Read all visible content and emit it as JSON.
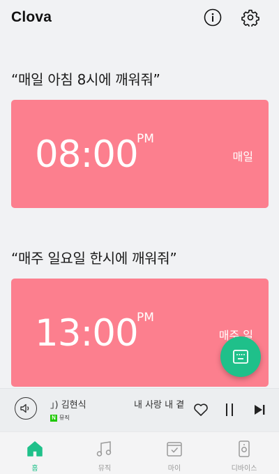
{
  "header": {
    "title": "Clova",
    "info_icon": "info-icon",
    "settings_icon": "gear-icon"
  },
  "alarms": [
    {
      "quote": "“매일 아침 8시에 깨워줘”",
      "time": "08:00",
      "ampm": "PM",
      "repeat": "매일"
    },
    {
      "quote": "“매주 일요일 한시에 깨워줘”",
      "time": "13:00",
      "ampm": "PM",
      "repeat": "매주 일"
    }
  ],
  "fab": {
    "icon": "keyboard-icon"
  },
  "player": {
    "artist": "」) 김현식",
    "source_logo": "N",
    "source": "뮤직",
    "title": "내 사랑 내 곁",
    "speaker_icon": "speaker-icon",
    "like_icon": "heart-icon",
    "pause_icon": "pause-icon",
    "next_icon": "skip-next-icon"
  },
  "nav": {
    "items": [
      {
        "label": "홈",
        "icon": "home-icon",
        "active": true
      },
      {
        "label": "뮤직",
        "icon": "music-icon",
        "active": false
      },
      {
        "label": "마이",
        "icon": "my-calendar-icon",
        "active": false
      },
      {
        "label": "디바이스",
        "icon": "device-icon",
        "active": false
      }
    ]
  },
  "colors": {
    "background": "#f1f2f4",
    "alarm_card": "#fc7f8e",
    "accent": "#1fc08a",
    "nav_inactive": "#999999"
  }
}
